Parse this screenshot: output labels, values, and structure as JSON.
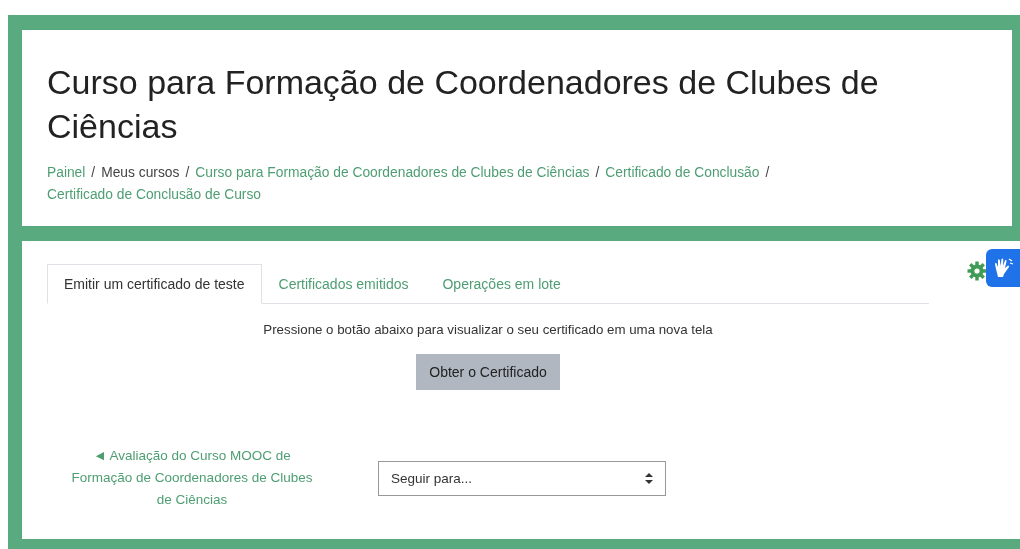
{
  "page_title": "Curso para Formação de Coordenadores de Clubes de Ciências",
  "breadcrumb_separator": "/",
  "breadcrumb": [
    {
      "label": "Painel",
      "link": true
    },
    {
      "label": "Meus cursos",
      "link": false
    },
    {
      "label": "Curso para Formação de Coordenadores de Clubes de Ciências",
      "link": true
    },
    {
      "label": "Certificado de Conclusão",
      "link": true
    },
    {
      "label": "Certificado de Conclusão de Curso",
      "link": true
    }
  ],
  "tabs": [
    {
      "label": "Emitir um certificado de teste",
      "selected": true
    },
    {
      "label": "Certificados emitidos",
      "selected": false
    },
    {
      "label": "Operações em lote",
      "selected": false
    }
  ],
  "instruction": "Pressione o botão abaixo para visualizar o seu certificado em uma nova tela",
  "button": "Obter o Certificado",
  "previous_link": "◄ Avaliação do Curso MOOC de Formação de Coordenadores de Clubes de Ciências",
  "jump_select": {
    "value": "Seguir para..."
  }
}
